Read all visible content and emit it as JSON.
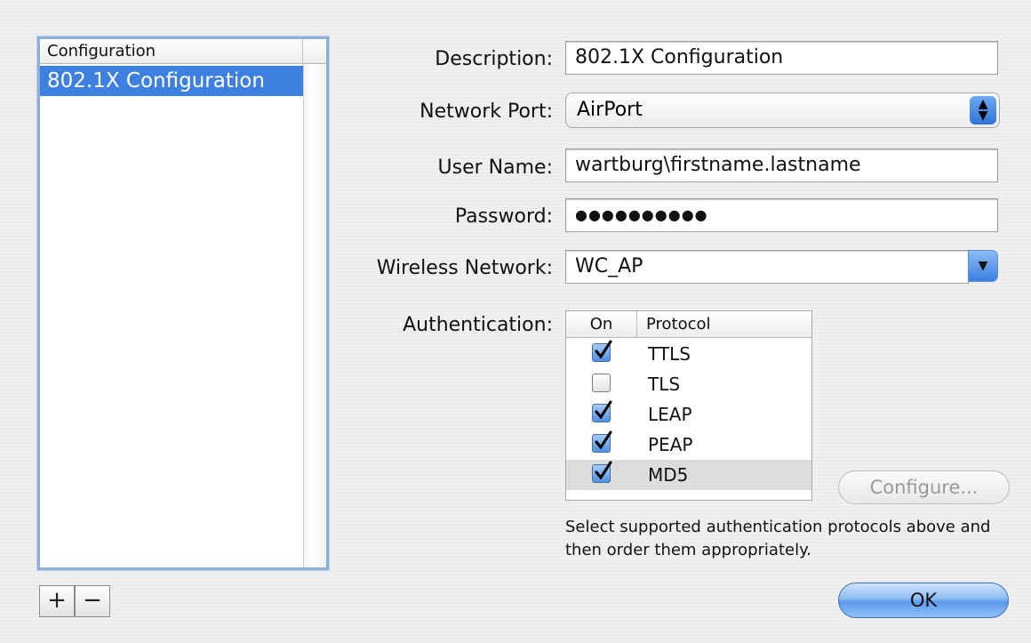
{
  "config_list": {
    "header": "Configuration",
    "items": [
      "802.1X Configuration"
    ],
    "add_label": "+",
    "remove_label": "−"
  },
  "form": {
    "description": {
      "label": "Description:",
      "value": "802.1X Configuration"
    },
    "network_port": {
      "label": "Network Port:",
      "value": "AirPort"
    },
    "user_name": {
      "label": "User Name:",
      "value": "wartburg\\firstname.lastname"
    },
    "password": {
      "label": "Password:",
      "value": "●●●●●●●●●●"
    },
    "wireless_network": {
      "label": "Wireless Network:",
      "value": "WC_AP"
    },
    "authentication": {
      "label": "Authentication:",
      "columns": [
        "On",
        "Protocol"
      ],
      "protocols": [
        {
          "name": "TTLS",
          "on": true
        },
        {
          "name": "TLS",
          "on": false
        },
        {
          "name": "LEAP",
          "on": true
        },
        {
          "name": "PEAP",
          "on": true
        },
        {
          "name": "MD5",
          "on": true
        }
      ],
      "selected_index": 4
    }
  },
  "buttons": {
    "configure": "Configure...",
    "ok": "OK"
  },
  "hint": "Select supported authentication protocols above and then order them appropriately."
}
